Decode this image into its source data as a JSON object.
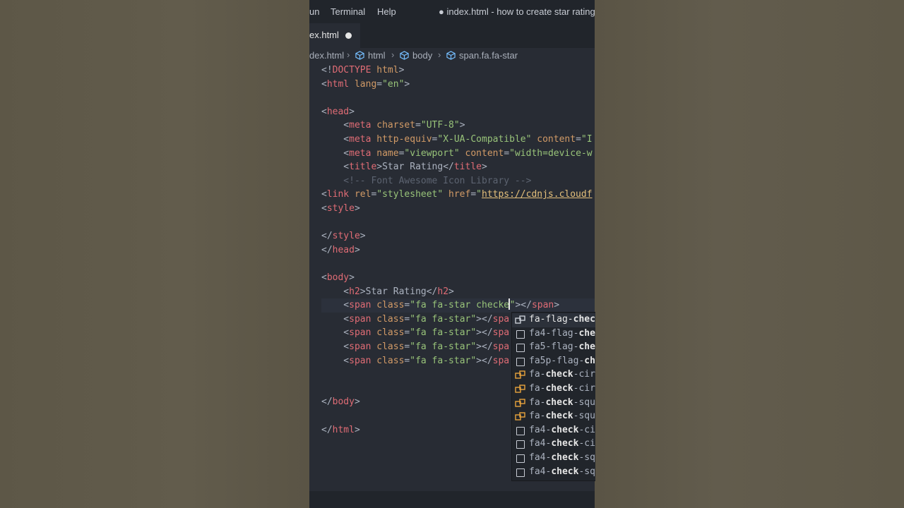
{
  "menubar": {
    "items": [
      "un",
      "Terminal",
      "Help"
    ],
    "title": "● index.html - how to create star rating u"
  },
  "tab": {
    "label": "ex.html"
  },
  "breadcrumb": {
    "items": [
      "dex.html",
      "html",
      "body",
      "span.fa.fa-star"
    ]
  },
  "code": {
    "l1": [
      "<!",
      "DOCTYPE",
      " html",
      ">"
    ],
    "l2": [
      "<",
      "html",
      " lang",
      "=",
      "\"en\"",
      ">"
    ],
    "l4": [
      "<",
      "head",
      ">"
    ],
    "l5": [
      "    <",
      "meta",
      " charset",
      "=",
      "\"UTF-8\"",
      ">"
    ],
    "l6": [
      "    <",
      "meta",
      " http-equiv",
      "=",
      "\"X-UA-Compatible\"",
      " content",
      "=",
      "\"I"
    ],
    "l7": [
      "    <",
      "meta",
      " name",
      "=",
      "\"viewport\"",
      " content",
      "=",
      "\"width=device-w"
    ],
    "l8": [
      "    <",
      "title",
      ">Star Rating</",
      "title",
      ">"
    ],
    "l9": "    <!-- Font Awesome Icon Library -->",
    "l10": [
      "<",
      "link",
      " rel",
      "=",
      "\"stylesheet\"",
      " href",
      "=",
      "\"",
      "https://cdnjs.cloudf"
    ],
    "l11": [
      "<",
      "style",
      ">"
    ],
    "l13": [
      "</",
      "style",
      ">"
    ],
    "l14": [
      "</",
      "head",
      ">"
    ],
    "l16": [
      "<",
      "body",
      ">"
    ],
    "l17": [
      "    <",
      "h2",
      ">Star Rating</",
      "h2",
      ">"
    ],
    "l18": [
      "    <",
      "span",
      " class",
      "=",
      "\"fa fa-star checke",
      "\"",
      "></",
      "span",
      ">"
    ],
    "l19": [
      "    <",
      "span",
      " class",
      "=",
      "\"fa fa-star\"",
      "></",
      "spa"
    ],
    "l20": [
      "    <",
      "span",
      " class",
      "=",
      "\"fa fa-star\"",
      "></",
      "spa"
    ],
    "l21": [
      "    <",
      "span",
      " class",
      "=",
      "\"fa fa-star\"",
      "></",
      "spa"
    ],
    "l22": [
      "    <",
      "span",
      " class",
      "=",
      "\"fa fa-star\"",
      "></",
      "spa"
    ],
    "l25": [
      "</",
      "body",
      ">"
    ],
    "l27": [
      "</",
      "html",
      ">"
    ]
  },
  "suggestions": [
    {
      "pre": "fa-flag-",
      "bold": "chec",
      "post": "",
      "icon": "property-icon"
    },
    {
      "pre": "fa4-flag-",
      "bold": "che",
      "post": "",
      "icon": "text-icon"
    },
    {
      "pre": "fa5-flag-",
      "bold": "che",
      "post": "",
      "icon": "text-icon"
    },
    {
      "pre": "fa5p-flag-",
      "bold": "ch",
      "post": "",
      "icon": "text-icon"
    },
    {
      "pre": "fa-",
      "bold": "check",
      "post": "-cir",
      "icon": "property-icon"
    },
    {
      "pre": "fa-",
      "bold": "check",
      "post": "-cir",
      "icon": "property-icon"
    },
    {
      "pre": "fa-",
      "bold": "check",
      "post": "-squ",
      "icon": "property-icon"
    },
    {
      "pre": "fa-",
      "bold": "check",
      "post": "-squ",
      "icon": "property-icon"
    },
    {
      "pre": "fa4-",
      "bold": "check",
      "post": "-ci",
      "icon": "text-icon"
    },
    {
      "pre": "fa4-",
      "bold": "check",
      "post": "-ci",
      "icon": "text-icon"
    },
    {
      "pre": "fa4-",
      "bold": "check",
      "post": "-sq",
      "icon": "text-icon"
    },
    {
      "pre": "fa4-",
      "bold": "check",
      "post": "-sq",
      "icon": "text-icon"
    }
  ]
}
